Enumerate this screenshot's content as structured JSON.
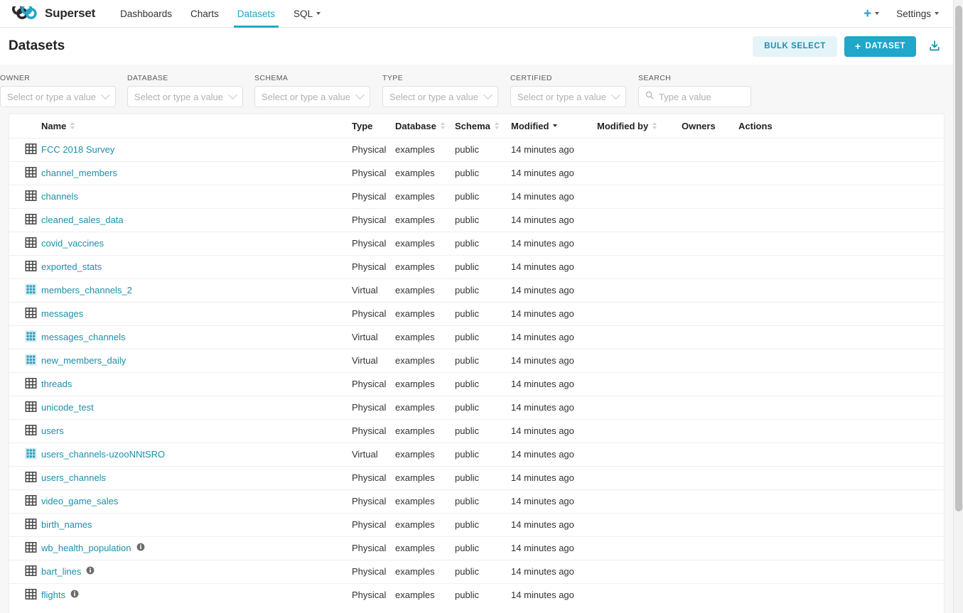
{
  "navbar": {
    "brand": "Superset",
    "brand_logo_icon": "superset-infinity-logo",
    "links": [
      {
        "label": "Dashboards",
        "active": false,
        "dropdown": false
      },
      {
        "label": "Charts",
        "active": false,
        "dropdown": false
      },
      {
        "label": "Datasets",
        "active": true,
        "dropdown": false
      },
      {
        "label": "SQL",
        "active": false,
        "dropdown": true
      }
    ],
    "plus_icon": "plus-icon",
    "plus_label": "+",
    "settings_label": "Settings"
  },
  "header": {
    "title": "Datasets",
    "bulk_select_label": "BULK SELECT",
    "new_dataset_label": "DATASET",
    "new_dataset_plus": "+",
    "export_icon": "download-icon"
  },
  "filters": [
    {
      "label": "OWNER",
      "placeholder": "Select or type a value",
      "value": "",
      "name": "owner"
    },
    {
      "label": "DATABASE",
      "placeholder": "Select or type a value",
      "value": "",
      "name": "database"
    },
    {
      "label": "SCHEMA",
      "placeholder": "Select or type a value",
      "value": "",
      "name": "schema"
    },
    {
      "label": "TYPE",
      "placeholder": "Select or type a value",
      "value": "",
      "name": "type"
    },
    {
      "label": "CERTIFIED",
      "placeholder": "Select or type a value",
      "value": "",
      "name": "certified"
    }
  ],
  "search": {
    "label": "SEARCH",
    "placeholder": "Type a value",
    "value": "",
    "icon": "search-icon"
  },
  "table": {
    "columns": [
      {
        "label": "Name",
        "sortable": true,
        "sorted": false
      },
      {
        "label": "Type",
        "sortable": false,
        "sorted": false
      },
      {
        "label": "Database",
        "sortable": true,
        "sorted": false
      },
      {
        "label": "Schema",
        "sortable": true,
        "sorted": false
      },
      {
        "label": "Modified",
        "sortable": true,
        "sorted": true,
        "direction": "desc"
      },
      {
        "label": "Modified by",
        "sortable": true,
        "sorted": false
      },
      {
        "label": "Owners",
        "sortable": false,
        "sorted": false
      },
      {
        "label": "Actions",
        "sortable": false,
        "sorted": false
      }
    ],
    "rows": [
      {
        "name": "FCC 2018 Survey",
        "type": "Physical",
        "database": "examples",
        "schema": "public",
        "modified": "14 minutes ago",
        "modified_by": "",
        "owners": "",
        "certified": false
      },
      {
        "name": "channel_members",
        "type": "Physical",
        "database": "examples",
        "schema": "public",
        "modified": "14 minutes ago",
        "modified_by": "",
        "owners": "",
        "certified": false
      },
      {
        "name": "channels",
        "type": "Physical",
        "database": "examples",
        "schema": "public",
        "modified": "14 minutes ago",
        "modified_by": "",
        "owners": "",
        "certified": false
      },
      {
        "name": "cleaned_sales_data",
        "type": "Physical",
        "database": "examples",
        "schema": "public",
        "modified": "14 minutes ago",
        "modified_by": "",
        "owners": "",
        "certified": false
      },
      {
        "name": "covid_vaccines",
        "type": "Physical",
        "database": "examples",
        "schema": "public",
        "modified": "14 minutes ago",
        "modified_by": "",
        "owners": "",
        "certified": false
      },
      {
        "name": "exported_stats",
        "type": "Physical",
        "database": "examples",
        "schema": "public",
        "modified": "14 minutes ago",
        "modified_by": "",
        "owners": "",
        "certified": false
      },
      {
        "name": "members_channels_2",
        "type": "Virtual",
        "database": "examples",
        "schema": "public",
        "modified": "14 minutes ago",
        "modified_by": "",
        "owners": "",
        "certified": false
      },
      {
        "name": "messages",
        "type": "Physical",
        "database": "examples",
        "schema": "public",
        "modified": "14 minutes ago",
        "modified_by": "",
        "owners": "",
        "certified": false
      },
      {
        "name": "messages_channels",
        "type": "Virtual",
        "database": "examples",
        "schema": "public",
        "modified": "14 minutes ago",
        "modified_by": "",
        "owners": "",
        "certified": false
      },
      {
        "name": "new_members_daily",
        "type": "Virtual",
        "database": "examples",
        "schema": "public",
        "modified": "14 minutes ago",
        "modified_by": "",
        "owners": "",
        "certified": false
      },
      {
        "name": "threads",
        "type": "Physical",
        "database": "examples",
        "schema": "public",
        "modified": "14 minutes ago",
        "modified_by": "",
        "owners": "",
        "certified": false
      },
      {
        "name": "unicode_test",
        "type": "Physical",
        "database": "examples",
        "schema": "public",
        "modified": "14 minutes ago",
        "modified_by": "",
        "owners": "",
        "certified": false
      },
      {
        "name": "users",
        "type": "Physical",
        "database": "examples",
        "schema": "public",
        "modified": "14 minutes ago",
        "modified_by": "",
        "owners": "",
        "certified": false
      },
      {
        "name": "users_channels-uzooNNtSRO",
        "type": "Virtual",
        "database": "examples",
        "schema": "public",
        "modified": "14 minutes ago",
        "modified_by": "",
        "owners": "",
        "certified": false
      },
      {
        "name": "users_channels",
        "type": "Physical",
        "database": "examples",
        "schema": "public",
        "modified": "14 minutes ago",
        "modified_by": "",
        "owners": "",
        "certified": false
      },
      {
        "name": "video_game_sales",
        "type": "Physical",
        "database": "examples",
        "schema": "public",
        "modified": "14 minutes ago",
        "modified_by": "",
        "owners": "",
        "certified": false
      },
      {
        "name": "birth_names",
        "type": "Physical",
        "database": "examples",
        "schema": "public",
        "modified": "14 minutes ago",
        "modified_by": "",
        "owners": "",
        "certified": false
      },
      {
        "name": "wb_health_population",
        "type": "Physical",
        "database": "examples",
        "schema": "public",
        "modified": "14 minutes ago",
        "modified_by": "",
        "owners": "",
        "certified": true
      },
      {
        "name": "bart_lines",
        "type": "Physical",
        "database": "examples",
        "schema": "public",
        "modified": "14 minutes ago",
        "modified_by": "",
        "owners": "",
        "certified": true
      },
      {
        "name": "flights",
        "type": "Physical",
        "database": "examples",
        "schema": "public",
        "modified": "14 minutes ago",
        "modified_by": "",
        "owners": "",
        "certified": true
      }
    ]
  },
  "colors": {
    "accent": "#20a7c9",
    "link": "#1d8fab",
    "bulk_select_bg": "#e5f4f8",
    "page_bg": "#f7f7f7",
    "virtual_icon": "#2b9ebb",
    "physical_icon": "#444444"
  }
}
